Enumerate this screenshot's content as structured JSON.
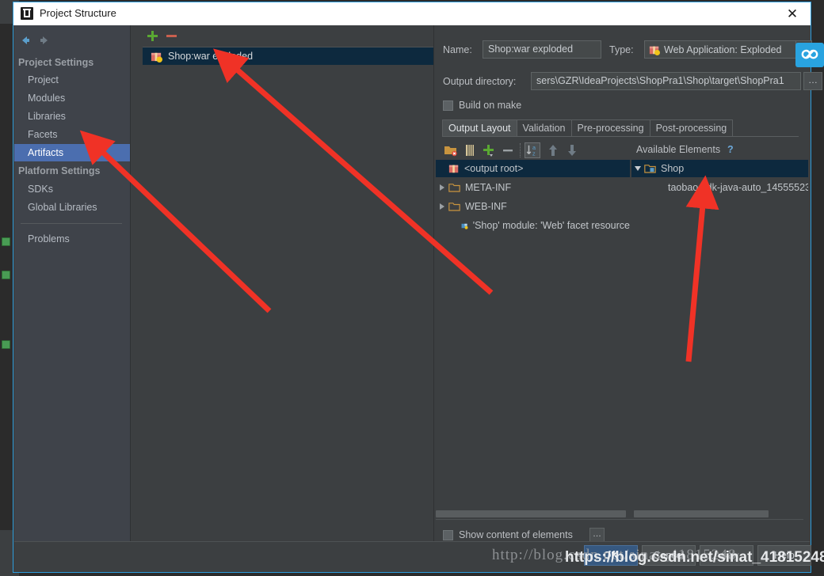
{
  "window": {
    "title": "Project Structure",
    "close_label": "✕",
    "app_icon": "intellij-idea-icon"
  },
  "sidebar": {
    "nav": {
      "back": "back-arrow-icon",
      "forward": "forward-arrow-icon"
    },
    "groups": [
      {
        "label": "Project Settings",
        "items": [
          {
            "label": "Project",
            "selected": false
          },
          {
            "label": "Modules",
            "selected": false
          },
          {
            "label": "Libraries",
            "selected": false
          },
          {
            "label": "Facets",
            "selected": false
          },
          {
            "label": "Artifacts",
            "selected": true
          }
        ]
      },
      {
        "label": "Platform Settings",
        "items": [
          {
            "label": "SDKs",
            "selected": false
          },
          {
            "label": "Global Libraries",
            "selected": false
          }
        ]
      }
    ],
    "problems": {
      "label": "Problems"
    }
  },
  "artifacts": {
    "toolbar": {
      "add": "+",
      "remove": "−"
    },
    "items": [
      {
        "label": "Shop:war exploded",
        "icon": "artifact-war-icon",
        "selected": true
      }
    ]
  },
  "detail": {
    "name_label": "Name:",
    "name_value": "Shop:war exploded",
    "type_label": "Type:",
    "type_value": "Web Application: Exploded",
    "type_icon": "artifact-war-icon",
    "output_dir_label": "Output directory:",
    "output_dir_value": "sers\\GZR\\IdeaProjects\\ShopPra1\\Shop\\target\\ShopPra1",
    "output_dir_browse": "…",
    "build_on_make_label": "Build on make",
    "build_on_make_checked": false,
    "tabs": [
      {
        "label": "Output Layout",
        "active": true
      },
      {
        "label": "Validation",
        "active": false
      },
      {
        "label": "Pre-processing",
        "active": false
      },
      {
        "label": "Post-processing",
        "active": false
      }
    ],
    "panel_toolbar": [
      {
        "name": "create-directory-icon"
      },
      {
        "name": "add-archive-icon"
      },
      {
        "name": "add-copy-of-icon"
      },
      {
        "name": "remove-icon"
      },
      {
        "name": "sort-alphabetically-icon"
      },
      {
        "name": "move-up-icon"
      },
      {
        "name": "move-down-icon"
      }
    ],
    "available_elements_label": "Available Elements",
    "help_icon_label": "?",
    "output_tree": [
      {
        "label": "<output root>",
        "icon": "artifact-war-icon",
        "indent": 0,
        "twist": "none",
        "selected": true
      },
      {
        "label": "META-INF",
        "icon": "folder-icon",
        "indent": 0,
        "twist": "closed",
        "selected": false
      },
      {
        "label": "WEB-INF",
        "icon": "folder-icon",
        "indent": 0,
        "twist": "closed",
        "selected": false
      },
      {
        "label": "'Shop' module: 'Web' facet resource",
        "icon": "module-facet-icon",
        "indent": 1,
        "twist": "none",
        "selected": false
      }
    ],
    "available_tree": [
      {
        "label": "Shop",
        "icon": "module-folder-icon",
        "indent": 0,
        "twist": "open",
        "selected": true
      },
      {
        "label": "taobao-sdk-java-auto_14555523",
        "icon": "jar-icon",
        "indent": 1,
        "twist": "none",
        "selected": false
      }
    ],
    "show_content_label": "Show content of elements",
    "show_content_checked": false,
    "show_content_browse": "…"
  },
  "buttons": [
    {
      "label": "OK",
      "style": "primary",
      "enabled": true
    },
    {
      "label": "Cancel",
      "style": "normal",
      "enabled": true
    },
    {
      "label": "Apply",
      "style": "disabled",
      "enabled": false
    },
    {
      "label": "Help",
      "style": "normal",
      "enabled": true
    }
  ],
  "watermarks": {
    "back": "http://blog.csdn.net/sinat_41815248",
    "front": "https://blog.csdn.net/sinat_41815248"
  },
  "badge": {
    "name": "cloud-sync-badge-icon",
    "color": "#29a3e0"
  },
  "colors": {
    "dialog_bg": "#3c3f41",
    "sidebar_bg": "#3f434a",
    "selection_blue": "#4b6eaf",
    "tree_selection": "#0d293e",
    "accent_border": "#2d9cdb",
    "primary_button": "#365880",
    "arrow_red": "#f03226"
  }
}
